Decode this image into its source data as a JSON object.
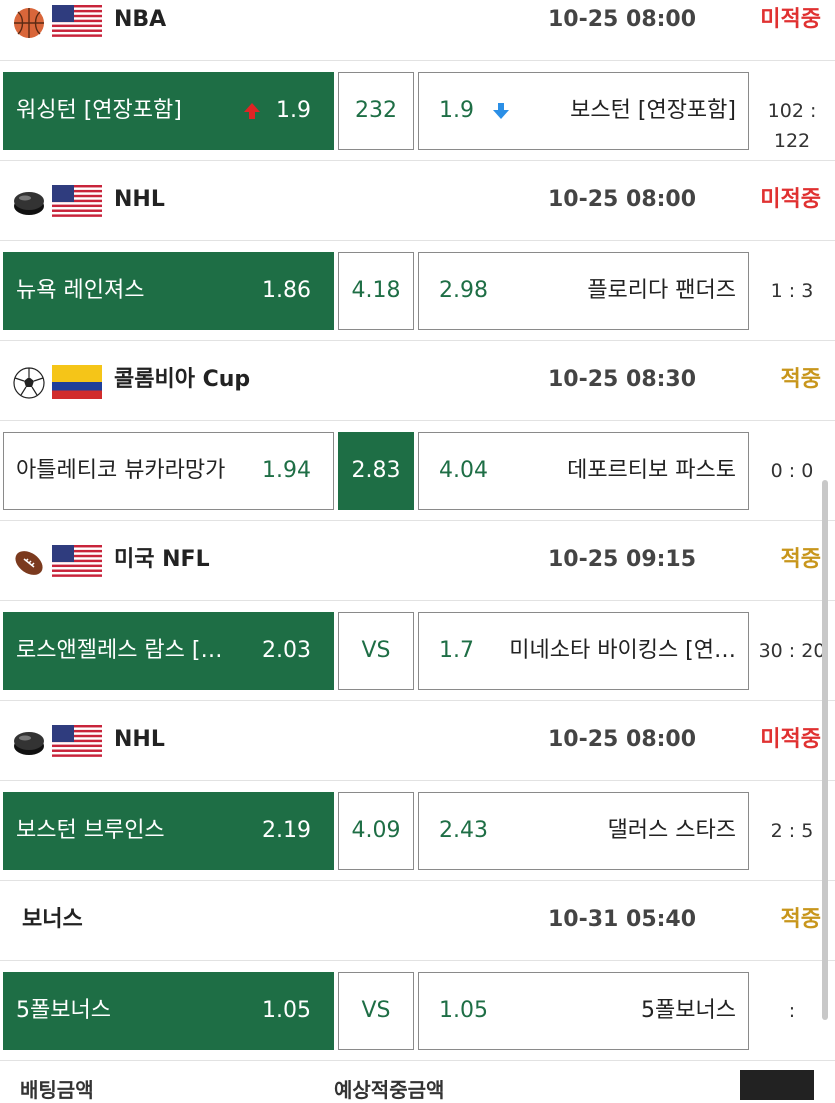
{
  "colors": {
    "accent_green": "#1e6e45",
    "miss_red": "#e03131",
    "hit_gold": "#c8961c"
  },
  "matches": [
    {
      "sport_icon": "basketball-icon",
      "flag_icon": "us-flag-icon",
      "league": "NBA",
      "datetime": "10-25 08:00",
      "status": "미적중",
      "status_type": "miss",
      "home": "워싱턴 [연장포함]",
      "home_odds": "1.9",
      "home_trend": "up",
      "middle": "232",
      "middle_selected": false,
      "away_odds": "1.9",
      "away_trend": "down",
      "away": "보스턴 [연장포함]",
      "selected": "home",
      "score": "102 : 122"
    },
    {
      "sport_icon": "hockey-puck-icon",
      "flag_icon": "us-flag-icon",
      "league": "NHL",
      "datetime": "10-25 08:00",
      "status": "미적중",
      "status_type": "miss",
      "home": "뉴욕 레인져스",
      "home_odds": "1.86",
      "middle": "4.18",
      "middle_selected": false,
      "away_odds": "2.98",
      "away": "플로리다 팬더즈",
      "selected": "home",
      "score": "1 : 3"
    },
    {
      "sport_icon": "soccer-ball-icon",
      "flag_icon": "colombia-flag-icon",
      "league": "콜롬비아 Cup",
      "datetime": "10-25 08:30",
      "status": "적중",
      "status_type": "hit",
      "home": "아틀레티코 뷰카라망가",
      "home_odds": "1.94",
      "middle": "2.83",
      "middle_selected": true,
      "away_odds": "4.04",
      "away": "데포르티보 파스토",
      "selected": "middle",
      "score": "0 : 0"
    },
    {
      "sport_icon": "football-icon",
      "flag_icon": "us-flag-icon",
      "league": "미국 NFL",
      "datetime": "10-25 09:15",
      "status": "적중",
      "status_type": "hit",
      "home": "로스앤젤레스 람스 [연장포함]",
      "home_odds": "2.03",
      "middle": "VS",
      "middle_selected": false,
      "away_odds": "1.7",
      "away": "미네소타 바이킹스 [연장포함]",
      "selected": "home",
      "score": "30 : 20"
    },
    {
      "sport_icon": "hockey-puck-icon",
      "flag_icon": "us-flag-icon",
      "league": "NHL",
      "datetime": "10-25 08:00",
      "status": "미적중",
      "status_type": "miss",
      "home": "보스턴 브루인스",
      "home_odds": "2.19",
      "middle": "4.09",
      "middle_selected": false,
      "away_odds": "2.43",
      "away": "댈러스 스타즈",
      "selected": "home",
      "score": "2 : 5"
    },
    {
      "sport_icon": "",
      "flag_icon": "",
      "league": "보너스",
      "datetime": "10-31 05:40",
      "status": "적중",
      "status_type": "hit",
      "home": "5폴보너스",
      "home_odds": "1.05",
      "middle": "VS",
      "middle_selected": false,
      "away_odds": "1.05",
      "away": "5폴보너스",
      "selected": "home",
      "score": ":"
    }
  ],
  "footer": {
    "bet_amount_label": "배팅금액",
    "expected_amount_label": "예상적중금액"
  }
}
